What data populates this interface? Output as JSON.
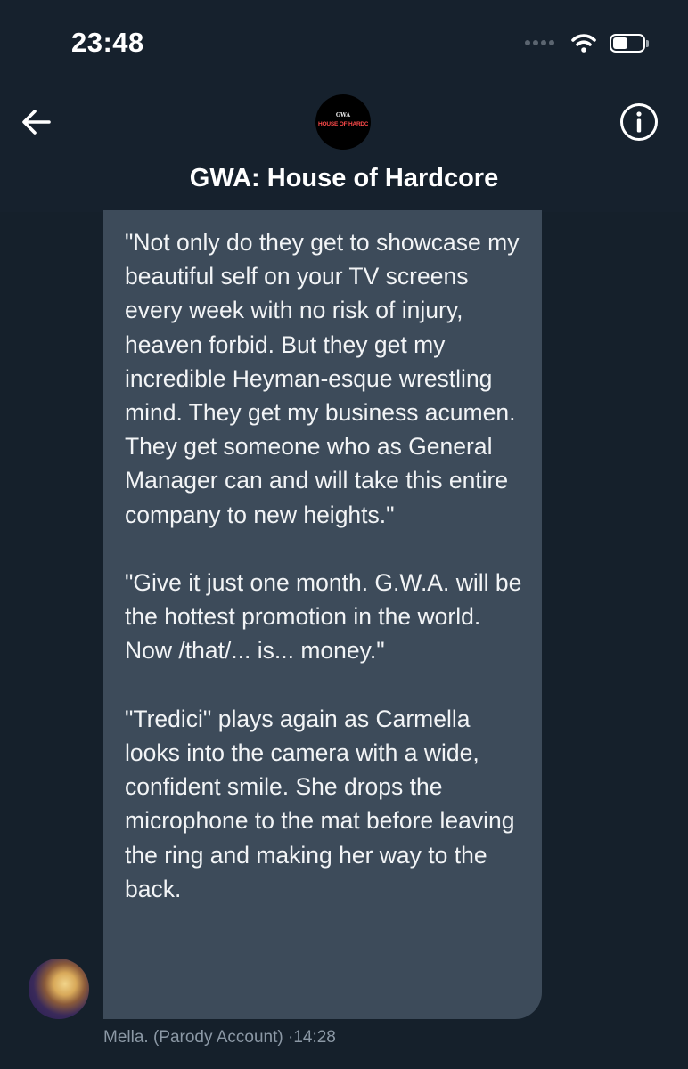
{
  "status_bar": {
    "time": "23:48"
  },
  "header": {
    "title": "GWA: House of Hardcore",
    "avatar_logo_small": "GWA",
    "avatar_logo_main": "HOUSE OF HARDCORE"
  },
  "message": {
    "paragraphs": [
      "\"Not only do they get to showcase my beautiful self on your TV screens every week with no risk of injury, heaven forbid. But they get my incredible Heyman-esque wrestling mind. They get my business acumen. They get someone who as General Manager can and will take this entire company to new heights.\"",
      "\"Give it just one month. G.W.A. will be the hottest promotion in the world. Now /that/... is... money.\"",
      "\"Tredici\" plays again as Carmella looks into the camera with a wide, confident smile. She drops the microphone to the mat before leaving the ring and making her way to the back."
    ],
    "sender": "Mella. (Parody Account)",
    "separator": "·",
    "time": "14:28"
  },
  "icons": {
    "back": "arrow-left-icon",
    "info": "info-icon",
    "wifi": "wifi-icon",
    "battery": "battery-icon"
  },
  "colors": {
    "background": "#15202b",
    "bubble": "#3d4b5a",
    "meta_text": "#8b98a5"
  }
}
